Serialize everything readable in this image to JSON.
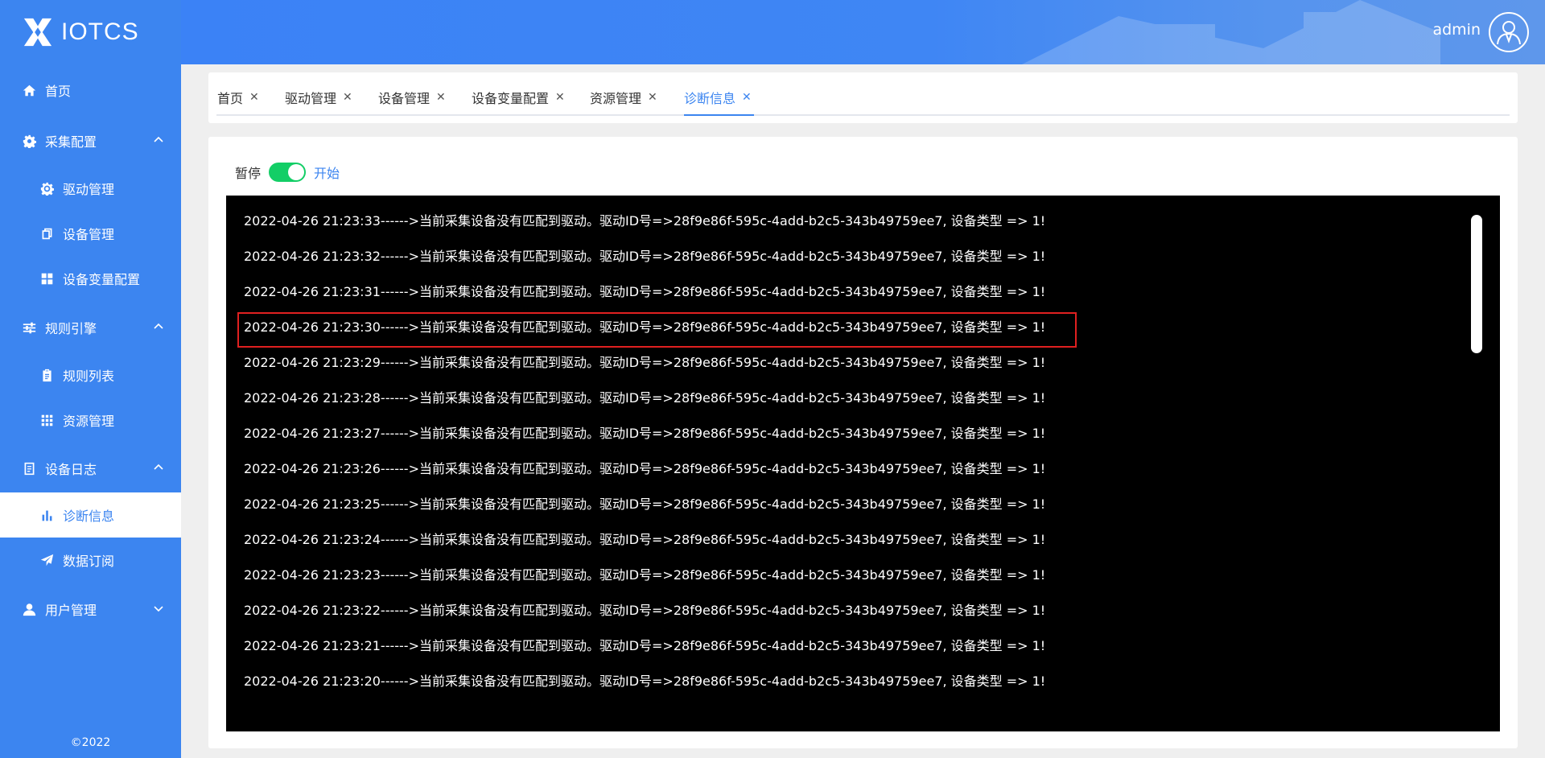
{
  "app": {
    "name": "IOTCS",
    "copyright": "©2022"
  },
  "sidebar": {
    "items": [
      {
        "label": "首页",
        "icon": "home-icon",
        "level": "top"
      },
      {
        "label": "采集配置",
        "icon": "gear-icon",
        "level": "top",
        "expanded": true
      },
      {
        "label": "驱动管理",
        "icon": "cog-outline-icon",
        "level": "sub"
      },
      {
        "label": "设备管理",
        "icon": "copy-icon",
        "level": "sub"
      },
      {
        "label": "设备变量配置",
        "icon": "grid-icon",
        "level": "sub"
      },
      {
        "label": "规则引擎",
        "icon": "sliders-icon",
        "level": "top",
        "expanded": true
      },
      {
        "label": "规则列表",
        "icon": "clipboard-icon",
        "level": "sub"
      },
      {
        "label": "资源管理",
        "icon": "apps-icon",
        "level": "sub"
      },
      {
        "label": "设备日志",
        "icon": "document-icon",
        "level": "top",
        "expanded": true
      },
      {
        "label": "诊断信息",
        "icon": "bar-chart-icon",
        "level": "sub",
        "active": true
      },
      {
        "label": "数据订阅",
        "icon": "send-icon",
        "level": "sub"
      },
      {
        "label": "用户管理",
        "icon": "user-icon",
        "level": "top",
        "expanded": false
      }
    ]
  },
  "header": {
    "username": "admin"
  },
  "tabs": [
    {
      "label": "首页"
    },
    {
      "label": "驱动管理"
    },
    {
      "label": "设备管理"
    },
    {
      "label": "设备变量配置"
    },
    {
      "label": "资源管理"
    },
    {
      "label": "诊断信息",
      "active": true
    }
  ],
  "tab_close_glyph": "✕",
  "controls": {
    "pause_label": "暂停",
    "start_label": "开始",
    "switch_on": true
  },
  "log": {
    "lines": [
      "2022-04-26 21:23:33------>当前采集设备没有匹配到驱动。驱动ID号=>28f9e86f-595c-4add-b2c5-343b49759ee7, 设备类型 => 1!",
      "2022-04-26 21:23:32------>当前采集设备没有匹配到驱动。驱动ID号=>28f9e86f-595c-4add-b2c5-343b49759ee7, 设备类型 => 1!",
      "2022-04-26 21:23:31------>当前采集设备没有匹配到驱动。驱动ID号=>28f9e86f-595c-4add-b2c5-343b49759ee7, 设备类型 => 1!",
      "2022-04-26 21:23:30------>当前采集设备没有匹配到驱动。驱动ID号=>28f9e86f-595c-4add-b2c5-343b49759ee7, 设备类型 => 1!",
      "2022-04-26 21:23:29------>当前采集设备没有匹配到驱动。驱动ID号=>28f9e86f-595c-4add-b2c5-343b49759ee7, 设备类型 => 1!",
      "2022-04-26 21:23:28------>当前采集设备没有匹配到驱动。驱动ID号=>28f9e86f-595c-4add-b2c5-343b49759ee7, 设备类型 => 1!",
      "2022-04-26 21:23:27------>当前采集设备没有匹配到驱动。驱动ID号=>28f9e86f-595c-4add-b2c5-343b49759ee7, 设备类型 => 1!",
      "2022-04-26 21:23:26------>当前采集设备没有匹配到驱动。驱动ID号=>28f9e86f-595c-4add-b2c5-343b49759ee7, 设备类型 => 1!",
      "2022-04-26 21:23:25------>当前采集设备没有匹配到驱动。驱动ID号=>28f9e86f-595c-4add-b2c5-343b49759ee7, 设备类型 => 1!",
      "2022-04-26 21:23:24------>当前采集设备没有匹配到驱动。驱动ID号=>28f9e86f-595c-4add-b2c5-343b49759ee7, 设备类型 => 1!",
      "2022-04-26 21:23:23------>当前采集设备没有匹配到驱动。驱动ID号=>28f9e86f-595c-4add-b2c5-343b49759ee7, 设备类型 => 1!",
      "2022-04-26 21:23:22------>当前采集设备没有匹配到驱动。驱动ID号=>28f9e86f-595c-4add-b2c5-343b49759ee7, 设备类型 => 1!",
      "2022-04-26 21:23:21------>当前采集设备没有匹配到驱动。驱动ID号=>28f9e86f-595c-4add-b2c5-343b49759ee7, 设备类型 => 1!",
      "2022-04-26 21:23:20------>当前采集设备没有匹配到驱动。驱动ID号=>28f9e86f-595c-4add-b2c5-343b49759ee7, 设备类型 => 1!"
    ]
  },
  "colors": {
    "primary": "#3c85f0",
    "switch_on": "#13ce66",
    "terminal_bg": "#000000",
    "highlight_border": "#e02020"
  }
}
